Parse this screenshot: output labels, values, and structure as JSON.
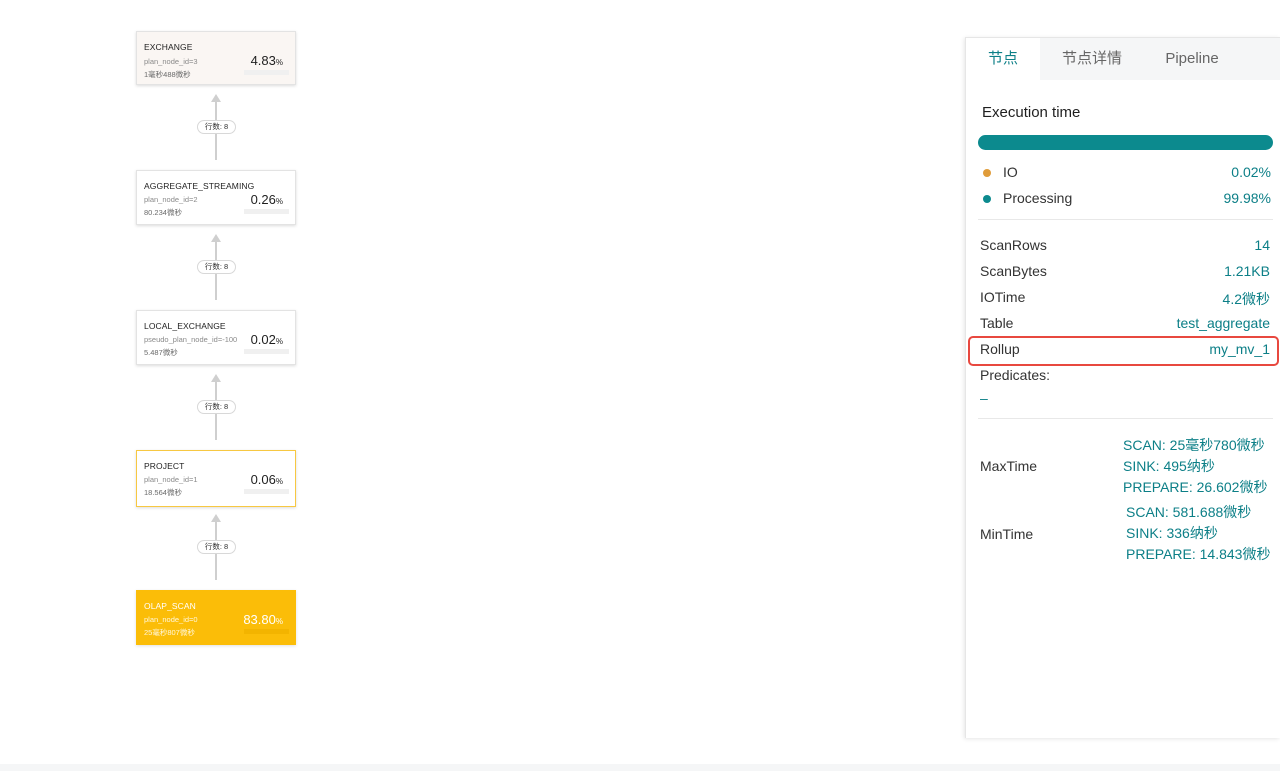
{
  "graph": {
    "nodes": [
      {
        "title": "EXCHANGE",
        "id": "plan_node_id=3",
        "time": "1毫秒488微秒",
        "pct": "4.83",
        "unit": "%"
      },
      {
        "title": "AGGREGATE_STREAMING",
        "id": "plan_node_id=2",
        "time": "80.234微秒",
        "pct": "0.26",
        "unit": "%"
      },
      {
        "title": "LOCAL_EXCHANGE",
        "id": "pseudo_plan_node_id=-100",
        "time": "5.487微秒",
        "pct": "0.02",
        "unit": "%"
      },
      {
        "title": "PROJECT",
        "id": "plan_node_id=1",
        "time": "18.564微秒",
        "pct": "0.06",
        "unit": "%"
      },
      {
        "title": "OLAP_SCAN",
        "id": "plan_node_id=0",
        "time": "25毫秒807微秒",
        "pct": "83.80",
        "unit": "%"
      }
    ],
    "edges": [
      {
        "label": "行数: 8"
      },
      {
        "label": "行数: 8"
      },
      {
        "label": "行数: 8"
      },
      {
        "label": "行数: 8"
      }
    ]
  },
  "panel": {
    "tabs": [
      {
        "label": "节点",
        "active": true
      },
      {
        "label": "节点详情",
        "active": false
      },
      {
        "label": "Pipeline",
        "active": false
      }
    ],
    "section_title": "Execution time",
    "execution_bar": {
      "io_fraction": 0.0002
    },
    "legend": [
      {
        "name": "IO",
        "value": "0.02%",
        "color": "#e09c3a"
      },
      {
        "name": "Processing",
        "value": "99.98%",
        "color": "#0c8a8e"
      }
    ],
    "stats": [
      {
        "key": "ScanRows",
        "value": "14"
      },
      {
        "key": "ScanBytes",
        "value": "1.21KB"
      },
      {
        "key": "IOTime",
        "value": "4.2微秒"
      },
      {
        "key": "Table",
        "value": "test_aggregate"
      },
      {
        "key": "Rollup",
        "value": "my_mv_1"
      }
    ],
    "predicates": {
      "key": "Predicates:",
      "value": "–"
    },
    "max_time": {
      "label": "MaxTime",
      "lines": [
        "SCAN: 25毫秒780微秒",
        "SINK: 495纳秒",
        "PREPARE: 26.602微秒"
      ]
    },
    "min_time": {
      "label": "MinTime",
      "lines": [
        "SCAN: 581.688微秒",
        "SINK: 336纳秒",
        "PREPARE: 14.843微秒"
      ]
    }
  },
  "colors": {
    "accent": "#0c7f87",
    "hot_node": "#fbbd08",
    "highlight_border": "#f7c842",
    "rollup_box": "#e8483f"
  }
}
